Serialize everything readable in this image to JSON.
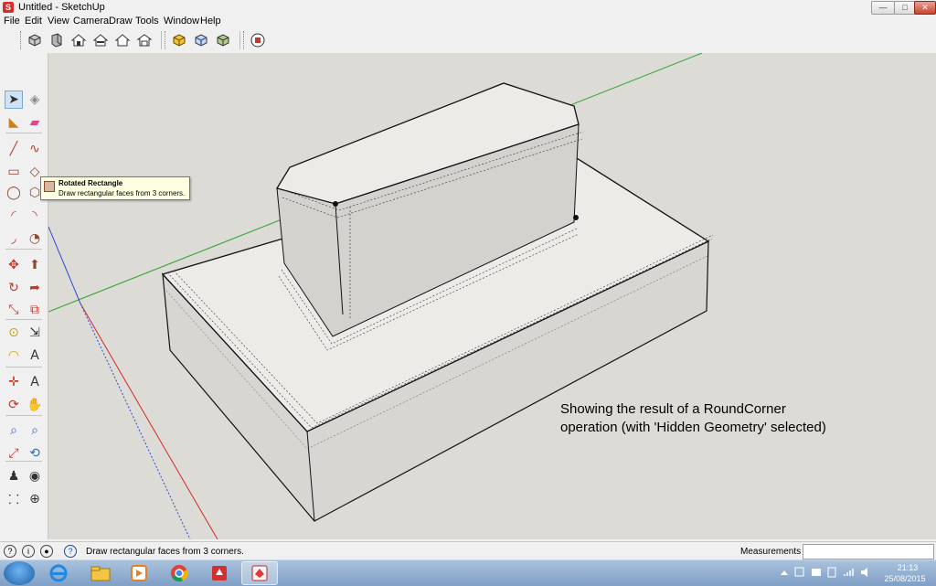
{
  "window": {
    "title": "Untitled - SketchUp",
    "app_icon_glyph": "S"
  },
  "window_controls": {
    "minimize": "—",
    "maximize": "□",
    "close": "✕"
  },
  "menu": [
    "File",
    "Edit",
    "View",
    "Camera",
    "Draw",
    "Tools",
    "Window",
    "Help"
  ],
  "toolbar_icons": [
    "views-iso-icon",
    "views-top-icon",
    "views-front-icon",
    "views-right-icon",
    "views-back-icon",
    "views-left-icon",
    "style-xray-icon",
    "style-backedges-icon",
    "style-shaded-icon",
    "extension-warehouse-icon"
  ],
  "tool_palette_icons": [
    "select-icon",
    "make-component-icon",
    "paint-bucket-icon",
    "eraser-icon",
    "line-icon",
    "freehand-icon",
    "rectangle-icon",
    "rotated-rectangle-icon",
    "circle-icon",
    "polygon-icon",
    "arc-icon",
    "two-point-arc-icon",
    "three-point-arc-icon",
    "pie-icon",
    "move-icon",
    "push-pull-icon",
    "rotate-icon",
    "follow-me-icon",
    "scale-icon",
    "offset-icon",
    "tape-measure-icon",
    "dimension-icon",
    "protractor-icon",
    "text-icon",
    "axes-icon",
    "3d-text-icon",
    "orbit-icon",
    "pan-icon",
    "zoom-icon",
    "zoom-window-icon",
    "zoom-extents-icon",
    "previous-view-icon",
    "position-camera-icon",
    "look-around-icon",
    "walk-icon",
    "section-plane-icon"
  ],
  "tooltip": {
    "title": "Rotated Rectangle",
    "description": "Draw rectangular faces from 3 corners."
  },
  "annotation": {
    "line1": "Showing the result of a RoundCorner",
    "line2": "operation (with 'Hidden Geometry' selected)"
  },
  "status": {
    "text": "Draw rectangular faces from 3 corners.",
    "measurements_label": "Measurements",
    "measurements_value": ""
  },
  "colors": {
    "viewport_bg": "#dcdbd6",
    "face": "#ecebe8",
    "side_face": "#d6d5d2",
    "axis_green": "#2ca02c",
    "axis_red": "#d62728",
    "axis_blue": "#2b4bd6"
  },
  "taskbar": {
    "apps": [
      "internet-explorer-icon",
      "file-explorer-icon",
      "media-player-icon",
      "chrome-icon",
      "sketchup-icon",
      "sketchup-active-icon"
    ],
    "time": "21:13",
    "date": "25/08/2015"
  }
}
